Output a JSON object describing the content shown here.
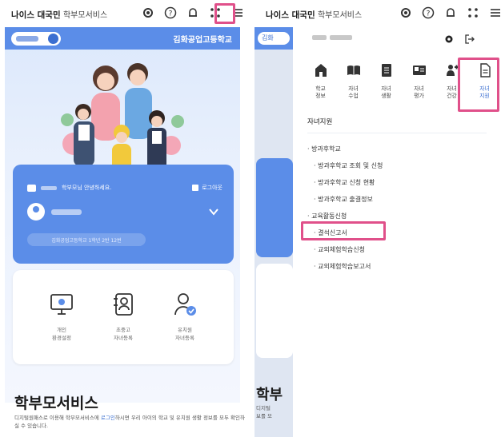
{
  "left": {
    "brand": {
      "bold": "나이스 대국민",
      "rest": "학부모서비스"
    },
    "school_name": "김화공업고등학교",
    "card": {
      "greeting": "학부모님 안녕하세요.",
      "logout": "로그아웃",
      "info_pill": "김화공업고등학교 1학년 2반 12번"
    },
    "quick_menu": [
      {
        "icon": "monitor-icon",
        "label1": "개인",
        "label2": "환경설정"
      },
      {
        "icon": "user-add-icon",
        "label1": "초중고",
        "label2": "자녀등록"
      },
      {
        "icon": "child-check-icon",
        "label1": "유치원",
        "label2": "자녀등록"
      }
    ],
    "service_title": "학부모서비스",
    "desc_before": "디지털원패스로 이용해 학부모서비스에 ",
    "desc_link": "로그인",
    "desc_after": "하시면 우리 아이의 학교 및 유치원 생활 정보를 모두 확인하실 수 있습니다."
  },
  "right": {
    "brand": {
      "bold": "나이스 대국민",
      "rest": "학부모서비스"
    },
    "bg_pill": "김화",
    "bg_title": "학부",
    "bg_desc1": "디지털",
    "bg_desc2": "보를 모",
    "menu": [
      {
        "icon": "school-icon",
        "label1": "학교",
        "label2": "정보"
      },
      {
        "icon": "book-icon",
        "label1": "자녀",
        "label2": "수업"
      },
      {
        "icon": "notebook-icon",
        "label1": "자녀",
        "label2": "생활"
      },
      {
        "icon": "report-card-icon",
        "label1": "자녀",
        "label2": "평가"
      },
      {
        "icon": "health-icon",
        "label1": "자녀",
        "label2": "건강"
      },
      {
        "icon": "document-icon",
        "label1": "자녀",
        "label2": "지원"
      }
    ],
    "section_title": "자녀지원",
    "sub_items": [
      {
        "text": "· 방과후학교",
        "level": 1
      },
      {
        "text": "· 방과후학교 조회 및 신청",
        "level": 2
      },
      {
        "text": "· 방과후학교 신청 현황",
        "level": 2
      },
      {
        "text": "· 방과후학교 출결정보",
        "level": 2
      },
      {
        "text": "· 교육활동신청",
        "level": 1
      },
      {
        "text": "· 결석신고서",
        "level": 2
      },
      {
        "text": "· 교외체험학습신청",
        "level": 2
      },
      {
        "text": "· 교외체험학습보고서",
        "level": 2
      }
    ]
  },
  "colors": {
    "primary": "#5b8de8",
    "highlight": "#e0508a",
    "active_text": "#3b6fd1"
  }
}
